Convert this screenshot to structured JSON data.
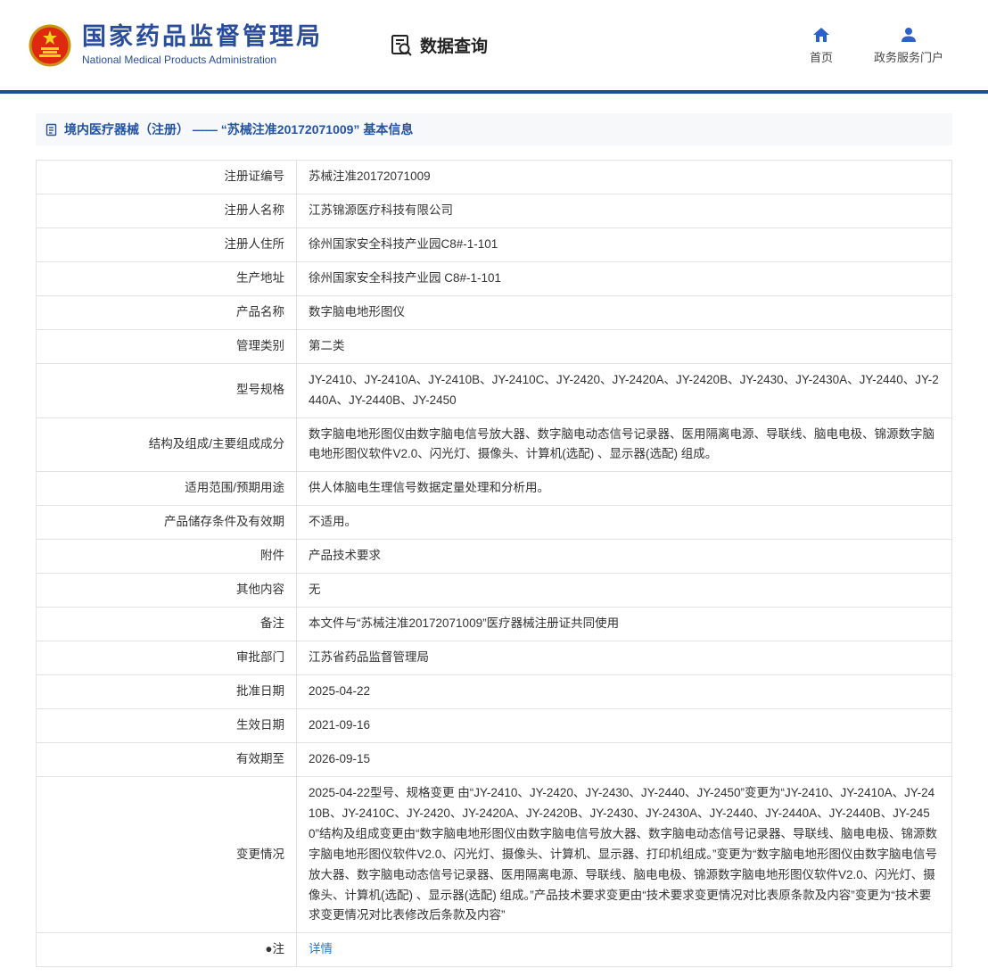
{
  "colors": {
    "brand_blue": "#2a4d9b",
    "divider_blue": "#1d4f9e",
    "title_blue": "#2353a4",
    "link_blue": "#1b7ad2",
    "emblem_red": "#de2910",
    "emblem_gold": "#f7d31e"
  },
  "header": {
    "title_cn": "国家药品监督管理局",
    "title_en": "National Medical Products Administration",
    "data_query_label": "数据查询",
    "nav": [
      {
        "label": "首页",
        "icon": "home-icon"
      },
      {
        "label": "政务服务门户",
        "icon": "user-icon"
      }
    ]
  },
  "page": {
    "title": "境内医疗器械（注册） —— “苏械注准20172071009” 基本信息"
  },
  "table": {
    "rows": [
      {
        "label": "注册证编号",
        "value": "苏械注准20172071009"
      },
      {
        "label": "注册人名称",
        "value": "江苏锦源医疗科技有限公司"
      },
      {
        "label": "注册人住所",
        "value": "徐州国家安全科技产业园C8#-1-101"
      },
      {
        "label": "生产地址",
        "value": "徐州国家安全科技产业园 C8#-1-101"
      },
      {
        "label": "产品名称",
        "value": "数字脑电地形图仪"
      },
      {
        "label": "管理类别",
        "value": "第二类"
      },
      {
        "label": "型号规格",
        "value": "JY-2410、JY-2410A、JY-2410B、JY-2410C、JY-2420、JY-2420A、JY-2420B、JY-2430、JY-2430A、JY-2440、JY-2440A、JY-2440B、JY-2450"
      },
      {
        "label": "结构及组成/主要组成成分",
        "value": "数字脑电地形图仪由数字脑电信号放大器、数字脑电动态信号记录器、医用隔离电源、导联线、脑电电极、锦源数字脑电地形图仪软件V2.0、闪光灯、摄像头、计算机(选配) 、显示器(选配) 组成。"
      },
      {
        "label": "适用范围/预期用途",
        "value": "供人体脑电生理信号数据定量处理和分析用。"
      },
      {
        "label": "产品储存条件及有效期",
        "value": "不适用。"
      },
      {
        "label": "附件",
        "value": "产品技术要求"
      },
      {
        "label": "其他内容",
        "value": "无"
      },
      {
        "label": "备注",
        "value": "本文件与“苏械注准20172071009”医疗器械注册证共同使用"
      },
      {
        "label": "审批部门",
        "value": "江苏省药品监督管理局"
      },
      {
        "label": "批准日期",
        "value": "2025-04-22"
      },
      {
        "label": "生效日期",
        "value": "2021-09-16"
      },
      {
        "label": "有效期至",
        "value": "2026-09-15"
      },
      {
        "label": "变更情况",
        "value": "2025-04-22型号、规格变更 由“JY-2410、JY-2420、JY-2430、JY-2440、JY-2450”变更为“JY-2410、JY-2410A、JY-2410B、JY-2410C、JY-2420、JY-2420A、JY-2420B、JY-2430、JY-2430A、JY-2440、JY-2440A、JY-2440B、JY-2450”结构及组成变更由“数字脑电地形图仪由数字脑电信号放大器、数字脑电动态信号记录器、导联线、脑电电极、锦源数字脑电地形图仪软件V2.0、闪光灯、摄像头、计算机、显示器、打印机组成。”变更为“数字脑电地形图仪由数字脑电信号放大器、数字脑电动态信号记录器、医用隔离电源、导联线、脑电电极、锦源数字脑电地形图仪软件V2.0、闪光灯、摄像头、计算机(选配) 、显示器(选配) 组成。”产品技术要求变更由“技术要求变更情况对比表原条款及内容”变更为“技术要求变更情况对比表修改后条款及内容”"
      },
      {
        "label": "●注",
        "value": "详情"
      }
    ]
  }
}
